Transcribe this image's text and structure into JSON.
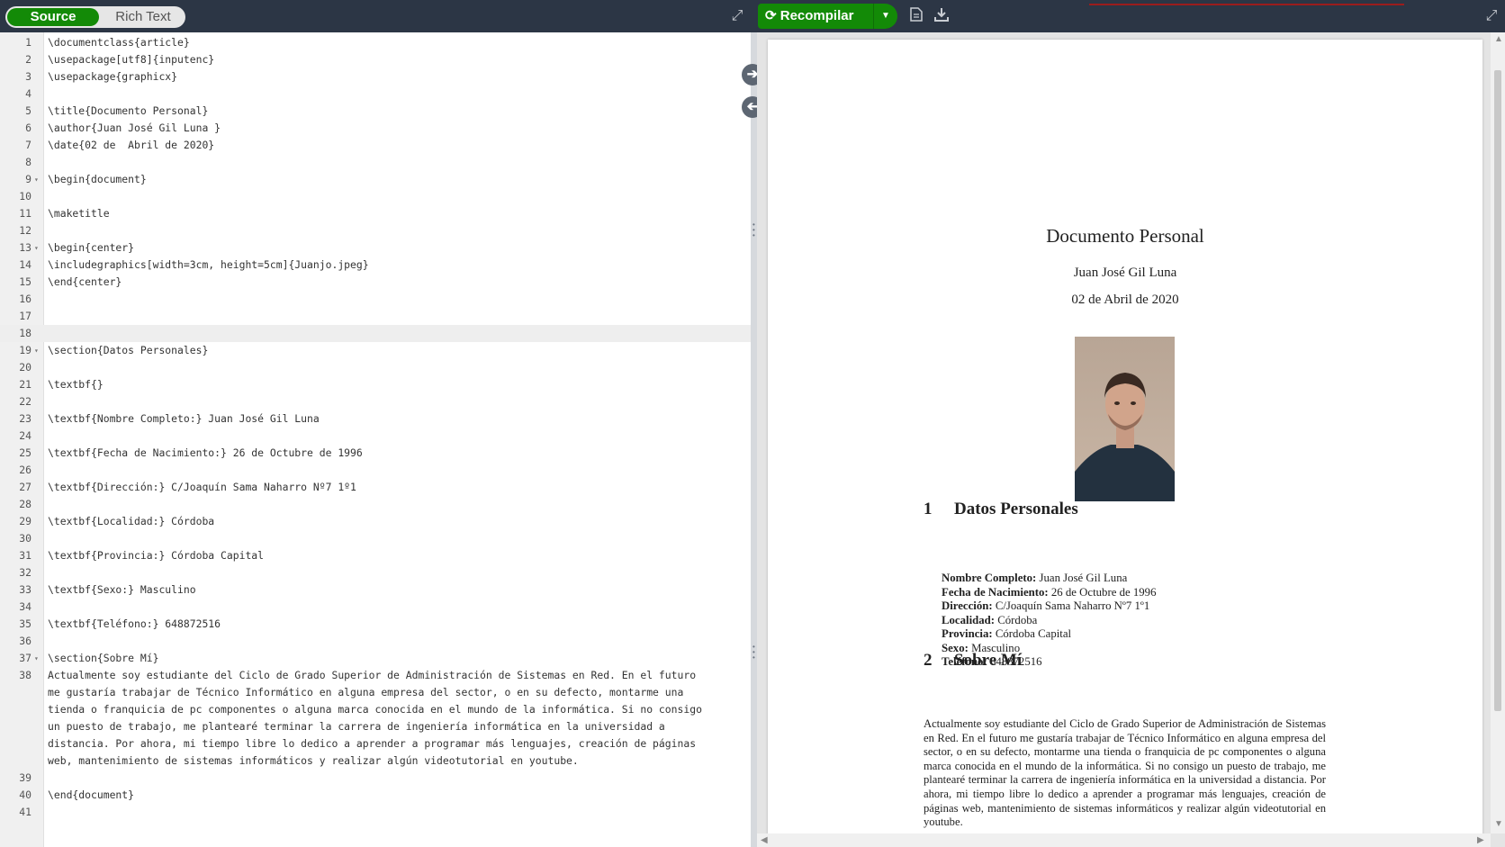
{
  "toolbar": {
    "source_label": "Source",
    "rich_text_label": "Rich Text",
    "recompile_label": "Recompilar",
    "icons": [
      "expand-icon",
      "refresh-icon",
      "caret-down-icon",
      "document-icon",
      "download-icon"
    ]
  },
  "editor": {
    "active_line": 18,
    "lines": [
      {
        "n": "1",
        "text": "\\documentclass{article}"
      },
      {
        "n": "2",
        "text": "\\usepackage[utf8]{inputenc}"
      },
      {
        "n": "3",
        "text": "\\usepackage{graphicx}"
      },
      {
        "n": "4",
        "text": ""
      },
      {
        "n": "5",
        "text": "\\title{Documento Personal}"
      },
      {
        "n": "6",
        "text": "\\author{Juan José Gil Luna }"
      },
      {
        "n": "7",
        "text": "\\date{02 de  Abril de 2020}"
      },
      {
        "n": "8",
        "text": ""
      },
      {
        "n": "9",
        "text": "\\begin{document}",
        "fold": true
      },
      {
        "n": "10",
        "text": ""
      },
      {
        "n": "11",
        "text": "\\maketitle"
      },
      {
        "n": "12",
        "text": ""
      },
      {
        "n": "13",
        "text": "\\begin{center}",
        "fold": true
      },
      {
        "n": "14",
        "text": "\\includegraphics[width=3cm, height=5cm]{Juanjo.jpeg}"
      },
      {
        "n": "15",
        "text": "\\end{center}"
      },
      {
        "n": "16",
        "text": ""
      },
      {
        "n": "17",
        "text": ""
      },
      {
        "n": "18",
        "text": ""
      },
      {
        "n": "19",
        "text": "\\section{Datos Personales}",
        "fold": true
      },
      {
        "n": "20",
        "text": ""
      },
      {
        "n": "21",
        "text": "\\textbf{}"
      },
      {
        "n": "22",
        "text": ""
      },
      {
        "n": "23",
        "text": "\\textbf{Nombre Completo:} Juan José Gil Luna"
      },
      {
        "n": "24",
        "text": ""
      },
      {
        "n": "25",
        "text": "\\textbf{Fecha de Nacimiento:} 26 de Octubre de 1996"
      },
      {
        "n": "26",
        "text": ""
      },
      {
        "n": "27",
        "text": "\\textbf{Dirección:} C/Joaquín Sama Naharro Nº7 1º1"
      },
      {
        "n": "28",
        "text": ""
      },
      {
        "n": "29",
        "text": "\\textbf{Localidad:} Córdoba"
      },
      {
        "n": "30",
        "text": ""
      },
      {
        "n": "31",
        "text": "\\textbf{Provincia:} Córdoba Capital"
      },
      {
        "n": "32",
        "text": ""
      },
      {
        "n": "33",
        "text": "\\textbf{Sexo:} Masculino"
      },
      {
        "n": "34",
        "text": ""
      },
      {
        "n": "35",
        "text": "\\textbf{Teléfono:} 648872516"
      },
      {
        "n": "36",
        "text": ""
      },
      {
        "n": "37",
        "text": "\\section{Sobre Mí}",
        "fold": true
      },
      {
        "n": "38",
        "text": "Actualmente soy estudiante del Ciclo de Grado Superior de Administración de Sistemas en Red. En el futuro"
      },
      {
        "n": "",
        "text": "me gustaría trabajar de Técnico Informático en alguna empresa del sector, o en su defecto, montarme una"
      },
      {
        "n": "",
        "text": "tienda o franquicia de pc componentes o alguna marca conocida en el mundo de la informática. Si no consigo"
      },
      {
        "n": "",
        "text": "un puesto de trabajo, me plantearé terminar la carrera de ingeniería informática en la universidad a"
      },
      {
        "n": "",
        "text": "distancia. Por ahora, mi tiempo libre lo dedico a aprender a programar más lenguajes, creación de páginas"
      },
      {
        "n": "",
        "text": "web, mantenimiento de sistemas informáticos y realizar algún videotutorial en youtube."
      },
      {
        "n": "39",
        "text": ""
      },
      {
        "n": "40",
        "text": "\\end{document}"
      },
      {
        "n": "41",
        "text": ""
      }
    ]
  },
  "preview": {
    "title": "Documento Personal",
    "author": "Juan José Gil Luna",
    "date": "02 de Abril de 2020",
    "section1": {
      "num": "1",
      "title": "Datos Personales"
    },
    "fields": [
      {
        "k": "Nombre Completo:",
        "v": "Juan José Gil Luna"
      },
      {
        "k": "Fecha de Nacimiento:",
        "v": "26 de Octubre de 1996"
      },
      {
        "k": "Dirección:",
        "v": "C/Joaquín Sama Naharro Nº7 1º1"
      },
      {
        "k": "Localidad:",
        "v": "Córdoba"
      },
      {
        "k": "Provincia:",
        "v": "Córdoba Capital"
      },
      {
        "k": "Sexo:",
        "v": "Masculino"
      },
      {
        "k": "Teléfono:",
        "v": "648872516"
      }
    ],
    "section2": {
      "num": "2",
      "title": "Sobre Mí"
    },
    "paragraph": "Actualmente soy estudiante del Ciclo de Grado Superior de Administración de Sistemas en Red. En el futuro me gustaría trabajar de Técnico Informático en alguna empresa del sector, o en su defecto, montarme una tienda o franquicia de pc componentes o alguna marca conocida en el mundo de la informática. Si no consigo un puesto de trabajo, me plantearé terminar la carrera de ingeniería informática en la universidad a distancia. Por ahora, mi tiempo libre lo dedico a aprender a programar más lenguajes, creación de páginas web, mantenimiento de sistemas informáticos y realizar algún videotutorial en youtube."
  },
  "colors": {
    "toolbar_bg": "#2c3645",
    "accent_green": "#138a07",
    "spell_underline": "#d9363e"
  }
}
